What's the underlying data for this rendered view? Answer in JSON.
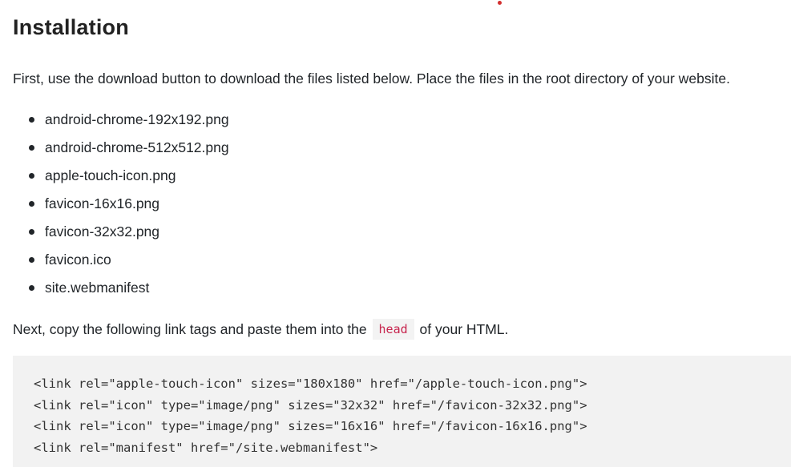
{
  "heading": "Installation",
  "intro_text": "First, use the download button to download the files listed below. Place the files in the root directory of your website.",
  "files": [
    "android-chrome-192x192.png",
    "android-chrome-512x512.png",
    "apple-touch-icon.png",
    "favicon-16x16.png",
    "favicon-32x32.png",
    "favicon.ico",
    "site.webmanifest"
  ],
  "next_text": {
    "before": "Next, copy the following link tags and paste them into the",
    "code": "head",
    "after": "of your HTML."
  },
  "code_lines": [
    "<link rel=\"apple-touch-icon\" sizes=\"180x180\" href=\"/apple-touch-icon.png\">",
    "<link rel=\"icon\" type=\"image/png\" sizes=\"32x32\" href=\"/favicon-32x32.png\">",
    "<link rel=\"icon\" type=\"image/png\" sizes=\"16x16\" href=\"/favicon-16x16.png\">",
    "<link rel=\"manifest\" href=\"/site.webmanifest\">"
  ],
  "colors": {
    "accent_dot": "#d32f2f",
    "inline_code": "#c7254e",
    "code_background": "#f2f2f2"
  }
}
